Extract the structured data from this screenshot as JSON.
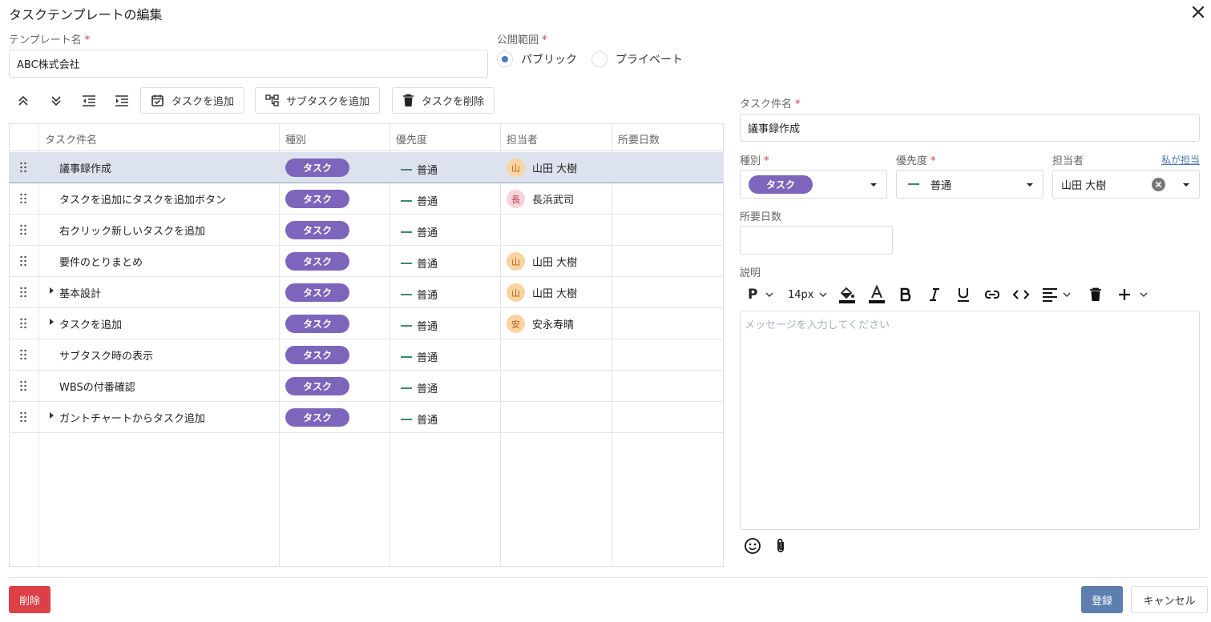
{
  "dialog": {
    "title": "タスクテンプレートの編集",
    "close_icon": "close-icon"
  },
  "template_name": {
    "label": "テンプレート名",
    "required_mark": "*",
    "value": "ABC株式会社"
  },
  "visibility": {
    "label": "公開範囲",
    "required_mark": "*",
    "options": [
      {
        "label": "パブリック",
        "selected": true
      },
      {
        "label": "プライベート",
        "selected": false
      }
    ]
  },
  "toolbar": {
    "move_up_icon": "chevrons-up-icon",
    "move_down_icon": "chevrons-down-icon",
    "outdent_icon": "outdent-icon",
    "indent_icon": "indent-icon",
    "add_task_label": "タスクを追加",
    "add_subtask_label": "サブタスクを追加",
    "delete_task_label": "タスクを削除"
  },
  "table": {
    "columns": [
      "タスク件名",
      "種別",
      "優先度",
      "担当者",
      "所要日数"
    ],
    "rows": [
      {
        "name": "議事録作成",
        "type": "タスク",
        "priority": "普通",
        "assignee": "山田 大樹",
        "avatar": "山",
        "avatar_color": "orange",
        "expandable": false,
        "selected": true
      },
      {
        "name": "タスクを追加にタスクを追加ボタン",
        "type": "タスク",
        "priority": "普通",
        "assignee": "長浜武司",
        "avatar": "長",
        "avatar_color": "pink",
        "expandable": false,
        "selected": false
      },
      {
        "name": "右クリック新しいタスクを追加",
        "type": "タスク",
        "priority": "普通",
        "assignee": "",
        "avatar": "",
        "avatar_color": "",
        "expandable": false,
        "selected": false
      },
      {
        "name": "要件のとりまとめ",
        "type": "タスク",
        "priority": "普通",
        "assignee": "山田 大樹",
        "avatar": "山",
        "avatar_color": "orange",
        "expandable": false,
        "selected": false
      },
      {
        "name": "基本設計",
        "type": "タスク",
        "priority": "普通",
        "assignee": "山田 大樹",
        "avatar": "山",
        "avatar_color": "orange",
        "expandable": true,
        "selected": false
      },
      {
        "name": "タスクを追加",
        "type": "タスク",
        "priority": "普通",
        "assignee": "安永寿晴",
        "avatar": "安",
        "avatar_color": "orange",
        "expandable": true,
        "selected": false
      },
      {
        "name": "サブタスク時の表示",
        "type": "タスク",
        "priority": "普通",
        "assignee": "",
        "avatar": "",
        "avatar_color": "",
        "expandable": false,
        "selected": false
      },
      {
        "name": "WBSの付番確認",
        "type": "タスク",
        "priority": "普通",
        "assignee": "",
        "avatar": "",
        "avatar_color": "",
        "expandable": false,
        "selected": false
      },
      {
        "name": "ガントチャートからタスク追加",
        "type": "タスク",
        "priority": "普通",
        "assignee": "",
        "avatar": "",
        "avatar_color": "",
        "expandable": true,
        "selected": false
      }
    ]
  },
  "detail": {
    "task_name_label": "タスク件名",
    "task_name_required": "*",
    "task_name_value": "議事録作成",
    "type_label": "種別",
    "type_required": "*",
    "type_value": "タスク",
    "priority_label": "優先度",
    "priority_required": "*",
    "priority_value": "普通",
    "assignee_label": "担当者",
    "assign_me_link": "私が担当",
    "assignee_value": "山田 大樹",
    "duration_label": "所要日数",
    "duration_value": "",
    "description_label": "説明",
    "editor": {
      "paragraph_label": "P",
      "font_size_label": "14px",
      "placeholder": "メッセージを入力してください"
    }
  },
  "footer": {
    "delete_label": "削除",
    "submit_label": "登録",
    "cancel_label": "キャンセル"
  },
  "colors": {
    "accent": "#5d7fb0",
    "badge": "#7e65bc",
    "danger": "#dc3f45",
    "priority": "#3a8a6a",
    "selected_row": "#dce3ee"
  }
}
